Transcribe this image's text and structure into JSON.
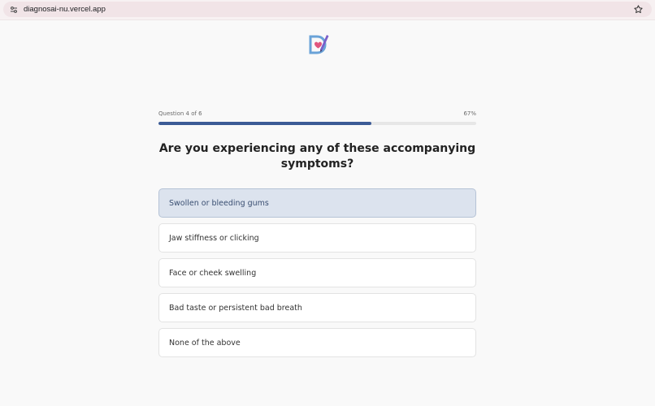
{
  "browser": {
    "url": "diagnosai-nu.vercel.app",
    "icons": {
      "site_settings": "tune-icon",
      "bookmark": "star-outline-icon"
    }
  },
  "quiz": {
    "progress_label": "Question 4 of 6",
    "progress_percent": "67%",
    "progress_value": 67,
    "question": "Are you experiencing any of these accompanying symptoms?",
    "options": [
      {
        "label": "Swollen or bleeding gums",
        "selected": true
      },
      {
        "label": "Jaw stiffness or clicking",
        "selected": false
      },
      {
        "label": "Face or cheek swelling",
        "selected": false
      },
      {
        "label": "Bad taste or persistent bad breath",
        "selected": false
      },
      {
        "label": "None of the above",
        "selected": false
      }
    ]
  },
  "colors": {
    "accent": "#3c5b96",
    "selected_bg": "#dce3ee",
    "browser_bar": "#f1e4e7"
  }
}
